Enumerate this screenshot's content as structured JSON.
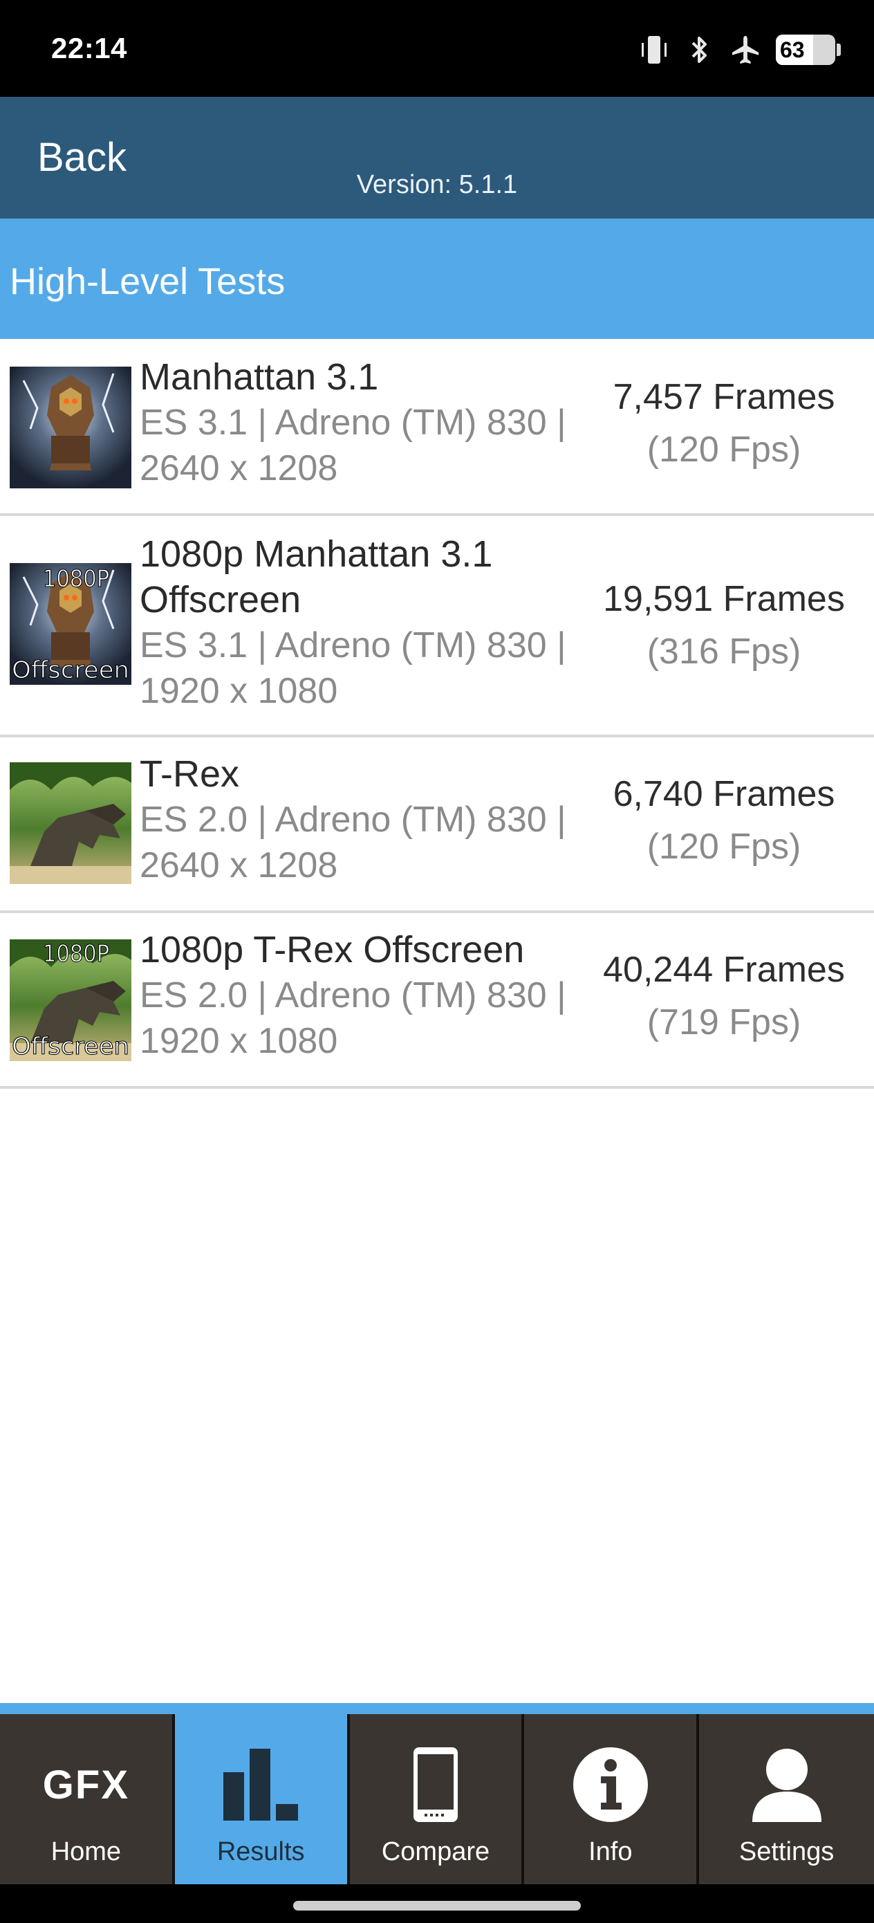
{
  "status_bar": {
    "time": "22:14",
    "battery_level": "63",
    "battery_fraction": 0.63,
    "icons": [
      "vibrate-icon",
      "bluetooth-icon",
      "airplane-mode-icon",
      "battery-icon"
    ]
  },
  "header": {
    "back_label": "Back",
    "version": "Version: 5.1.1",
    "color": "#2d5a7b"
  },
  "section": {
    "title": "High-Level Tests",
    "color": "#54aae8"
  },
  "tests": [
    {
      "name": "Manhattan 3.1",
      "details": "ES 3.1 | Adreno (TM) 830 | 2640 x 1208",
      "frames": "7,457 Frames",
      "fps": "(120 Fps)",
      "thumb_badges": []
    },
    {
      "name": "1080p Manhattan 3.1 Offscreen",
      "details": "ES 3.1 | Adreno (TM) 830 | 1920 x 1080",
      "frames": "19,591 Frames",
      "fps": "(316 Fps)",
      "thumb_badges": [
        "1080P",
        "Offscreen"
      ]
    },
    {
      "name": "T-Rex",
      "details": "ES 2.0 | Adreno (TM) 830 | 2640 x 1208",
      "frames": "6,740 Frames",
      "fps": "(120 Fps)",
      "thumb_badges": []
    },
    {
      "name": "1080p T-Rex Offscreen",
      "details": "ES 2.0 | Adreno (TM) 830 | 1920 x 1080",
      "frames": "40,244 Frames",
      "fps": "(719 Fps)",
      "thumb_badges": [
        "1080P",
        "Offscreen"
      ]
    }
  ],
  "tabbar": {
    "tabs": [
      {
        "label": "Home",
        "icon": "gfx-logo-icon",
        "logo_text": "GFX",
        "active": false
      },
      {
        "label": "Results",
        "icon": "bar-chart-icon",
        "active": true
      },
      {
        "label": "Compare",
        "icon": "phone-icon",
        "active": false
      },
      {
        "label": "Info",
        "icon": "info-icon",
        "active": false
      },
      {
        "label": "Settings",
        "icon": "user-icon",
        "active": false
      }
    ],
    "active_color": "#54aae8"
  }
}
